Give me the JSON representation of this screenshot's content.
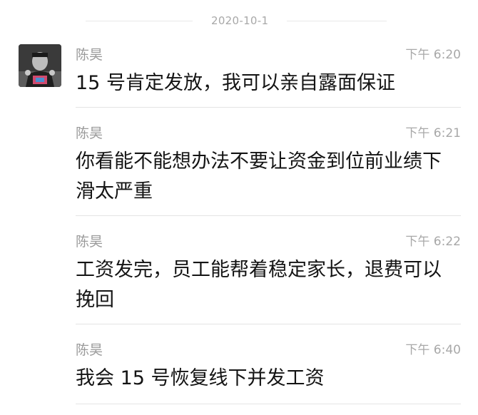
{
  "date_separator": "2020-10-1",
  "messages": [
    {
      "sender": "陈昊",
      "time": "下午 6:20",
      "text": "15 号肯定发放，我可以亲自露面保证"
    },
    {
      "sender": "陈昊",
      "time": "下午 6:21",
      "text": "你看能不能想办法不要让资金到位前业绩下滑太严重"
    },
    {
      "sender": "陈昊",
      "time": "下午 6:22",
      "text": "工资发完，员工能帮着稳定家长，退费可以挽回"
    },
    {
      "sender": "陈昊",
      "time": "下午 6:40",
      "text": "我会 15 号恢复线下并发工资"
    }
  ]
}
